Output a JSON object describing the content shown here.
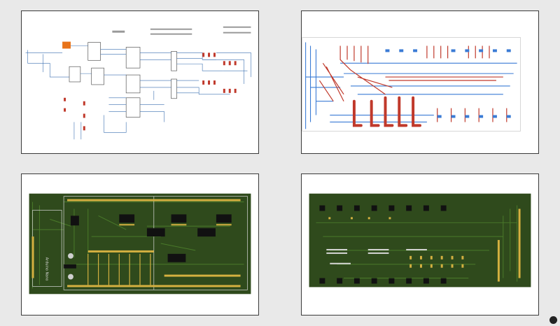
{
  "views": [
    {
      "id": "schematic",
      "name": "schematic-view"
    },
    {
      "id": "pcb_layout",
      "name": "pcb-layout-view"
    },
    {
      "id": "pcb_top",
      "name": "pcb-top-render"
    },
    {
      "id": "pcb_bottom",
      "name": "pcb-bottom-render"
    }
  ],
  "board": {
    "silkscreen_text": "Arduino Nano"
  },
  "colors": {
    "page_bg": "#e9e9e9",
    "panel_bg": "#ffffff",
    "schematic_wire": "#3a6fb0",
    "schematic_part": "#c0392b",
    "schematic_accent": "#e8731a",
    "copper_top": "#c0392b",
    "copper_bottom": "#3a7bd5",
    "board_green": "#2f4a1c",
    "trace_green": "#4a7a2a",
    "pad_gold": "#d4b040",
    "silk": "#d9d9d9"
  },
  "icons": {
    "corner_badge": "chat-bubble-icon"
  }
}
